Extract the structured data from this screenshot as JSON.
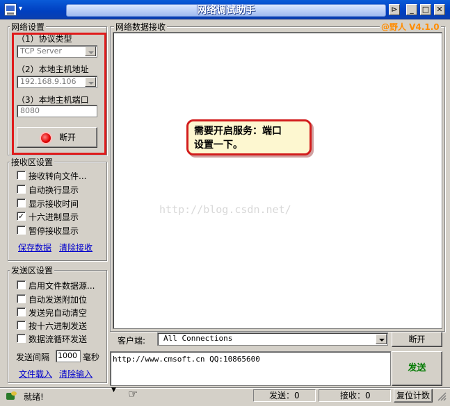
{
  "window": {
    "title": "网络调试助手",
    "sysmenu_glyph": "▾",
    "pin_glyph": "⊳",
    "min_glyph": "_",
    "max_glyph": "□",
    "close_glyph": "✕"
  },
  "net_settings": {
    "group_title": "网络设置",
    "protocol_label": "（1）协议类型",
    "protocol_value": "TCP Server",
    "host_label": "（2）本地主机地址",
    "host_value": "192.168.9.106",
    "port_label": "（3）本地主机端口",
    "port_value": "8080",
    "disconnect_button": "断开"
  },
  "recv_settings": {
    "group_title": "接收区设置",
    "options": [
      {
        "label": "接收转向文件...",
        "checked": false
      },
      {
        "label": "自动换行显示",
        "checked": false
      },
      {
        "label": "显示接收时间",
        "checked": false
      },
      {
        "label": "十六进制显示",
        "checked": true
      },
      {
        "label": "暂停接收显示",
        "checked": false
      }
    ],
    "save_link": "保存数据",
    "clear_link": "清除接收"
  },
  "send_settings": {
    "group_title": "发送区设置",
    "options": [
      {
        "label": "启用文件数据源...",
        "checked": false
      },
      {
        "label": "自动发送附加位",
        "checked": false
      },
      {
        "label": "发送完自动清空",
        "checked": false
      },
      {
        "label": "按十六进制发送",
        "checked": false
      },
      {
        "label": "数据流循环发送",
        "checked": false
      }
    ],
    "interval_label": "发送间隔",
    "interval_value": "1000",
    "interval_unit": "毫秒",
    "load_link": "文件载入",
    "clear_link": "清除输入"
  },
  "recv_panel": {
    "title": "网络数据接收",
    "version": "@野人 V4.1.0",
    "watermark": "http://blog.csdn.net/"
  },
  "callout": {
    "line1": "需要开启服务：端口",
    "line2": "设置一下。"
  },
  "client": {
    "label": "客户端:",
    "value": "All Connections",
    "disconnect_button": "断开"
  },
  "send_input": {
    "value": "http://www.cmsoft.cn QQ:10865600"
  },
  "send_button": "发送",
  "status": {
    "ready": "就绪!",
    "send_label": "发送：0",
    "recv_label": "接收：0",
    "reset_button": "复位计数"
  },
  "colors": {
    "callout_border": "#d21c1c",
    "callout_bg": "#fdf7d0",
    "version_color": "#ff8c00",
    "send_button_text": "#007a00",
    "highlight_border": "#e01b1b"
  }
}
